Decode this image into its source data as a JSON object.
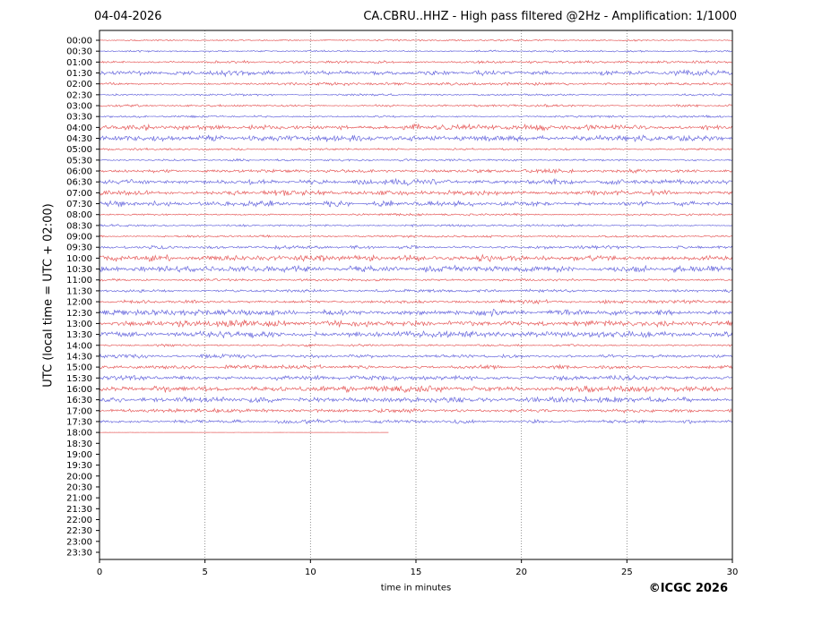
{
  "header": {
    "date": "04-04-2026",
    "title": "CA.CBRU..HHZ - High pass filtered @2Hz - Amplification: 1/1000"
  },
  "axes": {
    "ylabel": "UTC (local time = UTC + 02:00)",
    "xlabel": "time in minutes"
  },
  "footer": {
    "copyright": "©ICGC 2026"
  },
  "chart_data": {
    "type": "line",
    "subtype": "helicorder-daily-seismogram",
    "title": "CA.CBRU..HHZ - High pass filtered @2Hz - Amplification: 1/1000",
    "date": "04-04-2026",
    "xlabel": "time in minutes",
    "ylabel": "UTC (local time = UTC + 02:00)",
    "xlim": [
      0,
      30
    ],
    "x_ticks": [
      0,
      5,
      10,
      15,
      20,
      25,
      30
    ],
    "grid_minutes": [
      5,
      10,
      15,
      20,
      25
    ],
    "grid_color": "#777777",
    "minutes_per_row": 30,
    "trace_colors": {
      "red": "#e03434",
      "blue": "#4444d4"
    },
    "rows": [
      {
        "label": "00:00",
        "color": "red",
        "amplitude": 0.5,
        "end_minute": 30
      },
      {
        "label": "00:30",
        "color": "blue",
        "amplitude": 0.5,
        "end_minute": 30
      },
      {
        "label": "01:00",
        "color": "red",
        "amplitude": 0.7,
        "end_minute": 30
      },
      {
        "label": "01:30",
        "color": "blue",
        "amplitude": 1.4,
        "end_minute": 30
      },
      {
        "label": "02:00",
        "color": "red",
        "amplitude": 0.8,
        "end_minute": 30
      },
      {
        "label": "02:30",
        "color": "blue",
        "amplitude": 0.6,
        "end_minute": 30
      },
      {
        "label": "03:00",
        "color": "red",
        "amplitude": 0.6,
        "end_minute": 30
      },
      {
        "label": "03:30",
        "color": "blue",
        "amplitude": 0.6,
        "end_minute": 30
      },
      {
        "label": "04:00",
        "color": "red",
        "amplitude": 1.5,
        "end_minute": 30
      },
      {
        "label": "04:30",
        "color": "blue",
        "amplitude": 1.5,
        "end_minute": 30
      },
      {
        "label": "05:00",
        "color": "red",
        "amplitude": 0.6,
        "end_minute": 30
      },
      {
        "label": "05:30",
        "color": "blue",
        "amplitude": 0.6,
        "end_minute": 30
      },
      {
        "label": "06:00",
        "color": "red",
        "amplitude": 1.0,
        "end_minute": 30
      },
      {
        "label": "06:30",
        "color": "blue",
        "amplitude": 1.5,
        "end_minute": 30
      },
      {
        "label": "07:00",
        "color": "red",
        "amplitude": 1.5,
        "end_minute": 30
      },
      {
        "label": "07:30",
        "color": "blue",
        "amplitude": 1.5,
        "end_minute": 30
      },
      {
        "label": "08:00",
        "color": "red",
        "amplitude": 0.6,
        "end_minute": 30
      },
      {
        "label": "08:30",
        "color": "blue",
        "amplitude": 0.6,
        "end_minute": 30
      },
      {
        "label": "09:00",
        "color": "red",
        "amplitude": 0.6,
        "end_minute": 30
      },
      {
        "label": "09:30",
        "color": "blue",
        "amplitude": 0.9,
        "end_minute": 30
      },
      {
        "label": "10:00",
        "color": "red",
        "amplitude": 1.6,
        "end_minute": 30
      },
      {
        "label": "10:30",
        "color": "blue",
        "amplitude": 1.6,
        "end_minute": 30
      },
      {
        "label": "11:00",
        "color": "red",
        "amplitude": 0.6,
        "end_minute": 30
      },
      {
        "label": "11:30",
        "color": "blue",
        "amplitude": 0.8,
        "end_minute": 30
      },
      {
        "label": "12:00",
        "color": "red",
        "amplitude": 1.0,
        "end_minute": 30
      },
      {
        "label": "12:30",
        "color": "blue",
        "amplitude": 1.5,
        "end_minute": 30
      },
      {
        "label": "13:00",
        "color": "red",
        "amplitude": 1.7,
        "end_minute": 30
      },
      {
        "label": "13:30",
        "color": "blue",
        "amplitude": 1.6,
        "end_minute": 30
      },
      {
        "label": "14:00",
        "color": "red",
        "amplitude": 0.6,
        "end_minute": 30
      },
      {
        "label": "14:30",
        "color": "blue",
        "amplitude": 1.0,
        "end_minute": 30
      },
      {
        "label": "15:00",
        "color": "red",
        "amplitude": 1.0,
        "end_minute": 30
      },
      {
        "label": "15:30",
        "color": "blue",
        "amplitude": 1.3,
        "end_minute": 30
      },
      {
        "label": "16:00",
        "color": "red",
        "amplitude": 1.6,
        "end_minute": 30
      },
      {
        "label": "16:30",
        "color": "blue",
        "amplitude": 1.5,
        "end_minute": 30
      },
      {
        "label": "17:00",
        "color": "red",
        "amplitude": 1.0,
        "end_minute": 30
      },
      {
        "label": "17:30",
        "color": "blue",
        "amplitude": 1.0,
        "end_minute": 30
      },
      {
        "label": "18:00",
        "color": "red",
        "amplitude": 0.06,
        "end_minute": 13.7
      },
      {
        "label": "18:30",
        "color": "none",
        "amplitude": 0,
        "end_minute": 0
      },
      {
        "label": "19:00",
        "color": "none",
        "amplitude": 0,
        "end_minute": 0
      },
      {
        "label": "19:30",
        "color": "none",
        "amplitude": 0,
        "end_minute": 0
      },
      {
        "label": "20:00",
        "color": "none",
        "amplitude": 0,
        "end_minute": 0
      },
      {
        "label": "20:30",
        "color": "none",
        "amplitude": 0,
        "end_minute": 0
      },
      {
        "label": "21:00",
        "color": "none",
        "amplitude": 0,
        "end_minute": 0
      },
      {
        "label": "21:30",
        "color": "none",
        "amplitude": 0,
        "end_minute": 0
      },
      {
        "label": "22:00",
        "color": "none",
        "amplitude": 0,
        "end_minute": 0
      },
      {
        "label": "22:30",
        "color": "none",
        "amplitude": 0,
        "end_minute": 0
      },
      {
        "label": "23:00",
        "color": "none",
        "amplitude": 0,
        "end_minute": 0
      },
      {
        "label": "23:30",
        "color": "none",
        "amplitude": 0,
        "end_minute": 0
      }
    ]
  }
}
